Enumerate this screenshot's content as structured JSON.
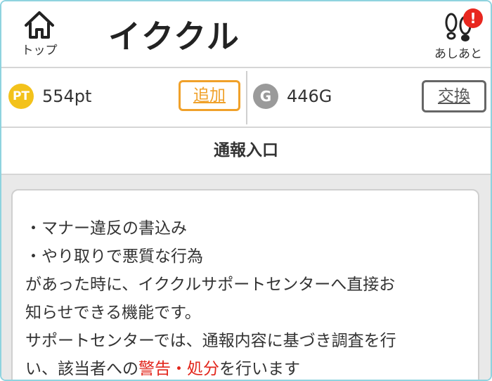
{
  "header": {
    "home_label": "トップ",
    "app_title": "イククル",
    "footprints_label": "あしあと",
    "footprints_badge": "!"
  },
  "points": {
    "pt_icon_text": "PT",
    "pt_balance": "554pt",
    "add_label": "追加",
    "g_icon_text": "G",
    "g_balance": "446G",
    "exchange_label": "交換"
  },
  "section": {
    "title": "通報入口"
  },
  "notice": {
    "item1": "・マナー違反の書込み",
    "item2": "・やり取りで悪質な行為",
    "line3": "があった時に、イククルサポートセンターへ直接お",
    "line4": "知らせできる機能です。",
    "line5": "サポートセンターでは、通報内容に基づき調査を行",
    "line6_pre": "い、該当者への",
    "line6_red": "警告・処分",
    "line6_post": "を行います"
  },
  "colors": {
    "frame_border": "#8fd3df",
    "accent_orange": "#f0a12a",
    "pt_coin": "#f3c21b",
    "g_coin": "#9a9a9a",
    "alert_red": "#e2261c",
    "content_bg": "#e9e9e9"
  },
  "icons": {
    "home": "home-icon",
    "footprints": "footprints-icon"
  }
}
